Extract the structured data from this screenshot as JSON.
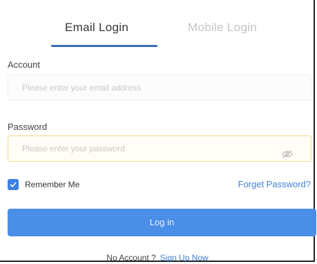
{
  "tabs": {
    "email": "Email Login",
    "mobile": "Mobile Login",
    "active": "email"
  },
  "account": {
    "label": "Account",
    "placeholder": "Please enter your email address",
    "value": ""
  },
  "password": {
    "label": "Password",
    "placeholder": "Please enter your password",
    "value": "",
    "toggle_icon": "eye-icon"
  },
  "remember": {
    "label": "Remember Me",
    "checked": true
  },
  "forgot_label": "Forget Password?",
  "login_label": "Log in",
  "signup": {
    "prompt": "No Account ?",
    "link": "Sign Up Now"
  },
  "colors": {
    "accent": "#4a8ee8",
    "tab_underline": "#3a6fb6",
    "link": "#3f80d6",
    "inactive_tab": "#c4c4c4",
    "password_border": "#f2d98a"
  }
}
